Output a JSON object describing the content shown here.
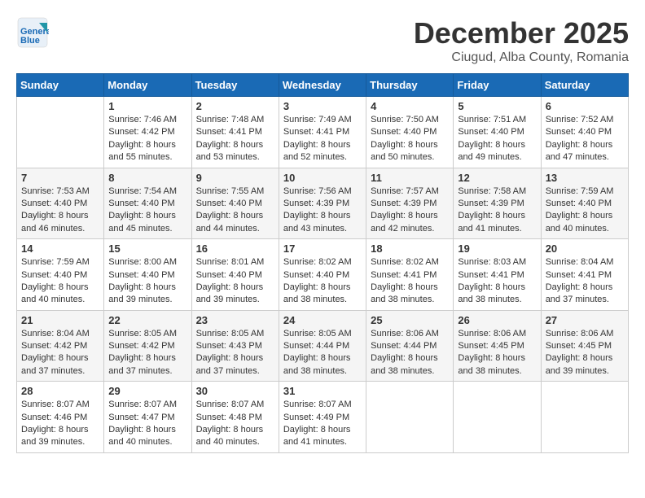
{
  "header": {
    "logo": {
      "line1": "General",
      "line2": "Blue"
    },
    "month": "December 2025",
    "location": "Ciugud, Alba County, Romania"
  },
  "weekdays": [
    "Sunday",
    "Monday",
    "Tuesday",
    "Wednesday",
    "Thursday",
    "Friday",
    "Saturday"
  ],
  "weeks": [
    [
      {
        "day": "",
        "sunrise": "",
        "sunset": "",
        "daylight": ""
      },
      {
        "day": "1",
        "sunrise": "Sunrise: 7:46 AM",
        "sunset": "Sunset: 4:42 PM",
        "daylight": "Daylight: 8 hours and 55 minutes."
      },
      {
        "day": "2",
        "sunrise": "Sunrise: 7:48 AM",
        "sunset": "Sunset: 4:41 PM",
        "daylight": "Daylight: 8 hours and 53 minutes."
      },
      {
        "day": "3",
        "sunrise": "Sunrise: 7:49 AM",
        "sunset": "Sunset: 4:41 PM",
        "daylight": "Daylight: 8 hours and 52 minutes."
      },
      {
        "day": "4",
        "sunrise": "Sunrise: 7:50 AM",
        "sunset": "Sunset: 4:40 PM",
        "daylight": "Daylight: 8 hours and 50 minutes."
      },
      {
        "day": "5",
        "sunrise": "Sunrise: 7:51 AM",
        "sunset": "Sunset: 4:40 PM",
        "daylight": "Daylight: 8 hours and 49 minutes."
      },
      {
        "day": "6",
        "sunrise": "Sunrise: 7:52 AM",
        "sunset": "Sunset: 4:40 PM",
        "daylight": "Daylight: 8 hours and 47 minutes."
      }
    ],
    [
      {
        "day": "7",
        "sunrise": "Sunrise: 7:53 AM",
        "sunset": "Sunset: 4:40 PM",
        "daylight": "Daylight: 8 hours and 46 minutes."
      },
      {
        "day": "8",
        "sunrise": "Sunrise: 7:54 AM",
        "sunset": "Sunset: 4:40 PM",
        "daylight": "Daylight: 8 hours and 45 minutes."
      },
      {
        "day": "9",
        "sunrise": "Sunrise: 7:55 AM",
        "sunset": "Sunset: 4:40 PM",
        "daylight": "Daylight: 8 hours and 44 minutes."
      },
      {
        "day": "10",
        "sunrise": "Sunrise: 7:56 AM",
        "sunset": "Sunset: 4:39 PM",
        "daylight": "Daylight: 8 hours and 43 minutes."
      },
      {
        "day": "11",
        "sunrise": "Sunrise: 7:57 AM",
        "sunset": "Sunset: 4:39 PM",
        "daylight": "Daylight: 8 hours and 42 minutes."
      },
      {
        "day": "12",
        "sunrise": "Sunrise: 7:58 AM",
        "sunset": "Sunset: 4:39 PM",
        "daylight": "Daylight: 8 hours and 41 minutes."
      },
      {
        "day": "13",
        "sunrise": "Sunrise: 7:59 AM",
        "sunset": "Sunset: 4:40 PM",
        "daylight": "Daylight: 8 hours and 40 minutes."
      }
    ],
    [
      {
        "day": "14",
        "sunrise": "Sunrise: 7:59 AM",
        "sunset": "Sunset: 4:40 PM",
        "daylight": "Daylight: 8 hours and 40 minutes."
      },
      {
        "day": "15",
        "sunrise": "Sunrise: 8:00 AM",
        "sunset": "Sunset: 4:40 PM",
        "daylight": "Daylight: 8 hours and 39 minutes."
      },
      {
        "day": "16",
        "sunrise": "Sunrise: 8:01 AM",
        "sunset": "Sunset: 4:40 PM",
        "daylight": "Daylight: 8 hours and 39 minutes."
      },
      {
        "day": "17",
        "sunrise": "Sunrise: 8:02 AM",
        "sunset": "Sunset: 4:40 PM",
        "daylight": "Daylight: 8 hours and 38 minutes."
      },
      {
        "day": "18",
        "sunrise": "Sunrise: 8:02 AM",
        "sunset": "Sunset: 4:41 PM",
        "daylight": "Daylight: 8 hours and 38 minutes."
      },
      {
        "day": "19",
        "sunrise": "Sunrise: 8:03 AM",
        "sunset": "Sunset: 4:41 PM",
        "daylight": "Daylight: 8 hours and 38 minutes."
      },
      {
        "day": "20",
        "sunrise": "Sunrise: 8:04 AM",
        "sunset": "Sunset: 4:41 PM",
        "daylight": "Daylight: 8 hours and 37 minutes."
      }
    ],
    [
      {
        "day": "21",
        "sunrise": "Sunrise: 8:04 AM",
        "sunset": "Sunset: 4:42 PM",
        "daylight": "Daylight: 8 hours and 37 minutes."
      },
      {
        "day": "22",
        "sunrise": "Sunrise: 8:05 AM",
        "sunset": "Sunset: 4:42 PM",
        "daylight": "Daylight: 8 hours and 37 minutes."
      },
      {
        "day": "23",
        "sunrise": "Sunrise: 8:05 AM",
        "sunset": "Sunset: 4:43 PM",
        "daylight": "Daylight: 8 hours and 37 minutes."
      },
      {
        "day": "24",
        "sunrise": "Sunrise: 8:05 AM",
        "sunset": "Sunset: 4:44 PM",
        "daylight": "Daylight: 8 hours and 38 minutes."
      },
      {
        "day": "25",
        "sunrise": "Sunrise: 8:06 AM",
        "sunset": "Sunset: 4:44 PM",
        "daylight": "Daylight: 8 hours and 38 minutes."
      },
      {
        "day": "26",
        "sunrise": "Sunrise: 8:06 AM",
        "sunset": "Sunset: 4:45 PM",
        "daylight": "Daylight: 8 hours and 38 minutes."
      },
      {
        "day": "27",
        "sunrise": "Sunrise: 8:06 AM",
        "sunset": "Sunset: 4:45 PM",
        "daylight": "Daylight: 8 hours and 39 minutes."
      }
    ],
    [
      {
        "day": "28",
        "sunrise": "Sunrise: 8:07 AM",
        "sunset": "Sunset: 4:46 PM",
        "daylight": "Daylight: 8 hours and 39 minutes."
      },
      {
        "day": "29",
        "sunrise": "Sunrise: 8:07 AM",
        "sunset": "Sunset: 4:47 PM",
        "daylight": "Daylight: 8 hours and 40 minutes."
      },
      {
        "day": "30",
        "sunrise": "Sunrise: 8:07 AM",
        "sunset": "Sunset: 4:48 PM",
        "daylight": "Daylight: 8 hours and 40 minutes."
      },
      {
        "day": "31",
        "sunrise": "Sunrise: 8:07 AM",
        "sunset": "Sunset: 4:49 PM",
        "daylight": "Daylight: 8 hours and 41 minutes."
      },
      {
        "day": "",
        "sunrise": "",
        "sunset": "",
        "daylight": ""
      },
      {
        "day": "",
        "sunrise": "",
        "sunset": "",
        "daylight": ""
      },
      {
        "day": "",
        "sunrise": "",
        "sunset": "",
        "daylight": ""
      }
    ]
  ]
}
